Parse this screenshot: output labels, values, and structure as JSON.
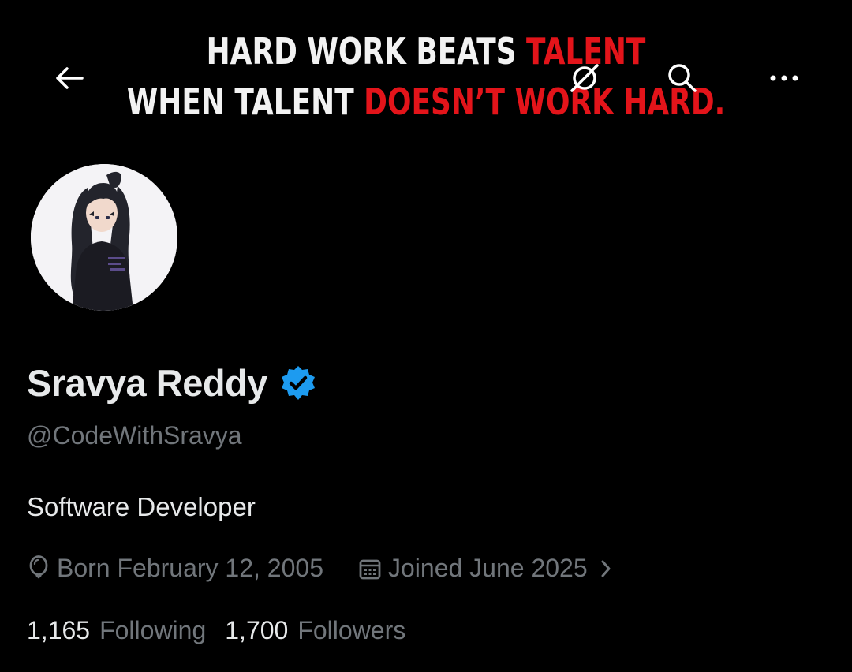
{
  "banner": {
    "line1_white": "HARD WORK BEATS ",
    "line1_red": "TALENT",
    "line2_white": "WHEN TALENT ",
    "line2_red": "DOESN’T WORK HARD.",
    "accent_color": "#e3141a"
  },
  "topbar": {
    "back_icon": "arrow-left-icon",
    "offline_icon": "crossed-circle-icon",
    "search_icon": "search-icon",
    "more_icon": "more-horizontal-icon"
  },
  "profile": {
    "display_name": "Sravya Reddy",
    "verified": true,
    "verified_color": "#1d9bf0",
    "handle": "@CodeWithSravya",
    "bio": "Software Developer",
    "birthday": "Born February 12, 2005",
    "joined": "Joined June 2025",
    "following_count": "1,165",
    "following_label": "Following",
    "followers_count": "1,700",
    "followers_label": "Followers"
  },
  "colors": {
    "background": "#000000",
    "primary_text": "#e7e9ea",
    "secondary_text": "#71767b"
  }
}
